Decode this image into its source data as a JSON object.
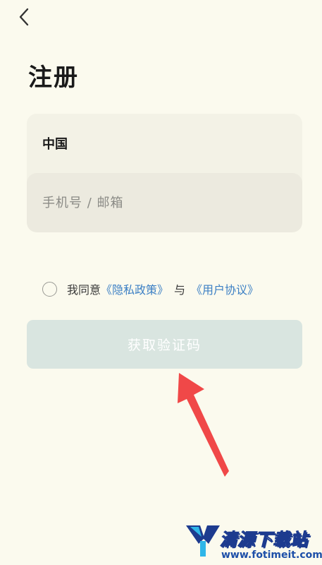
{
  "page": {
    "title": "注册"
  },
  "form": {
    "country": "中国",
    "phone_placeholder": "手机号 / 邮箱"
  },
  "agreement": {
    "prefix": "我同意",
    "privacy_link": "《隐私政策》",
    "joiner": "与",
    "user_link": "《用户协议》"
  },
  "actions": {
    "get_code_label": "获取验证码"
  },
  "watermark": {
    "name": "清源下载站",
    "url": "www.fotimeit.com"
  },
  "colors": {
    "background": "#fbfaee",
    "card": "#f3f2e6",
    "link": "#3b7fc4",
    "button_disabled": "#d9e5e0",
    "arrow": "#f04848"
  },
  "icons": {
    "back": "chevron-left-icon",
    "radio": "radio-unchecked-icon"
  }
}
